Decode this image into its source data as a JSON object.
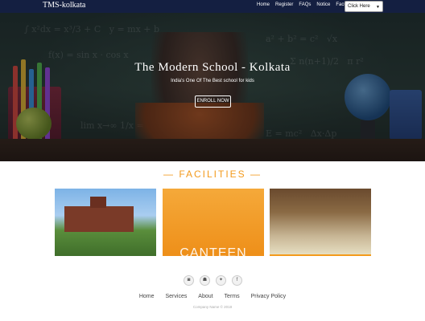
{
  "nav": {
    "brand": "TMS-kolkata",
    "links": [
      "Home",
      "Register",
      "FAQs",
      "Notice",
      "Faculty"
    ],
    "select_value": "Click Here"
  },
  "hero": {
    "title": "The Modern School - Kolkata",
    "subtitle": "India's One Of The Best school for kids",
    "enroll_label": "ENROLL NOW"
  },
  "facilities": {
    "heading": "— FACILITIES —",
    "cards": [
      {
        "name": "school building photo"
      },
      {
        "name": "canteen photo",
        "overlay_text": "CANTEEN"
      },
      {
        "name": "library photo"
      }
    ]
  },
  "footer": {
    "socials": [
      "instagram-icon",
      "snapchat-icon",
      "twitter-icon",
      "facebook-icon"
    ],
    "links": [
      "Home",
      "Services",
      "About",
      "Terms",
      "Privacy Policy"
    ],
    "copyright": "Company Name © 2018"
  },
  "colors": {
    "accent": "#f39a1c",
    "navbar": "#141e46"
  }
}
